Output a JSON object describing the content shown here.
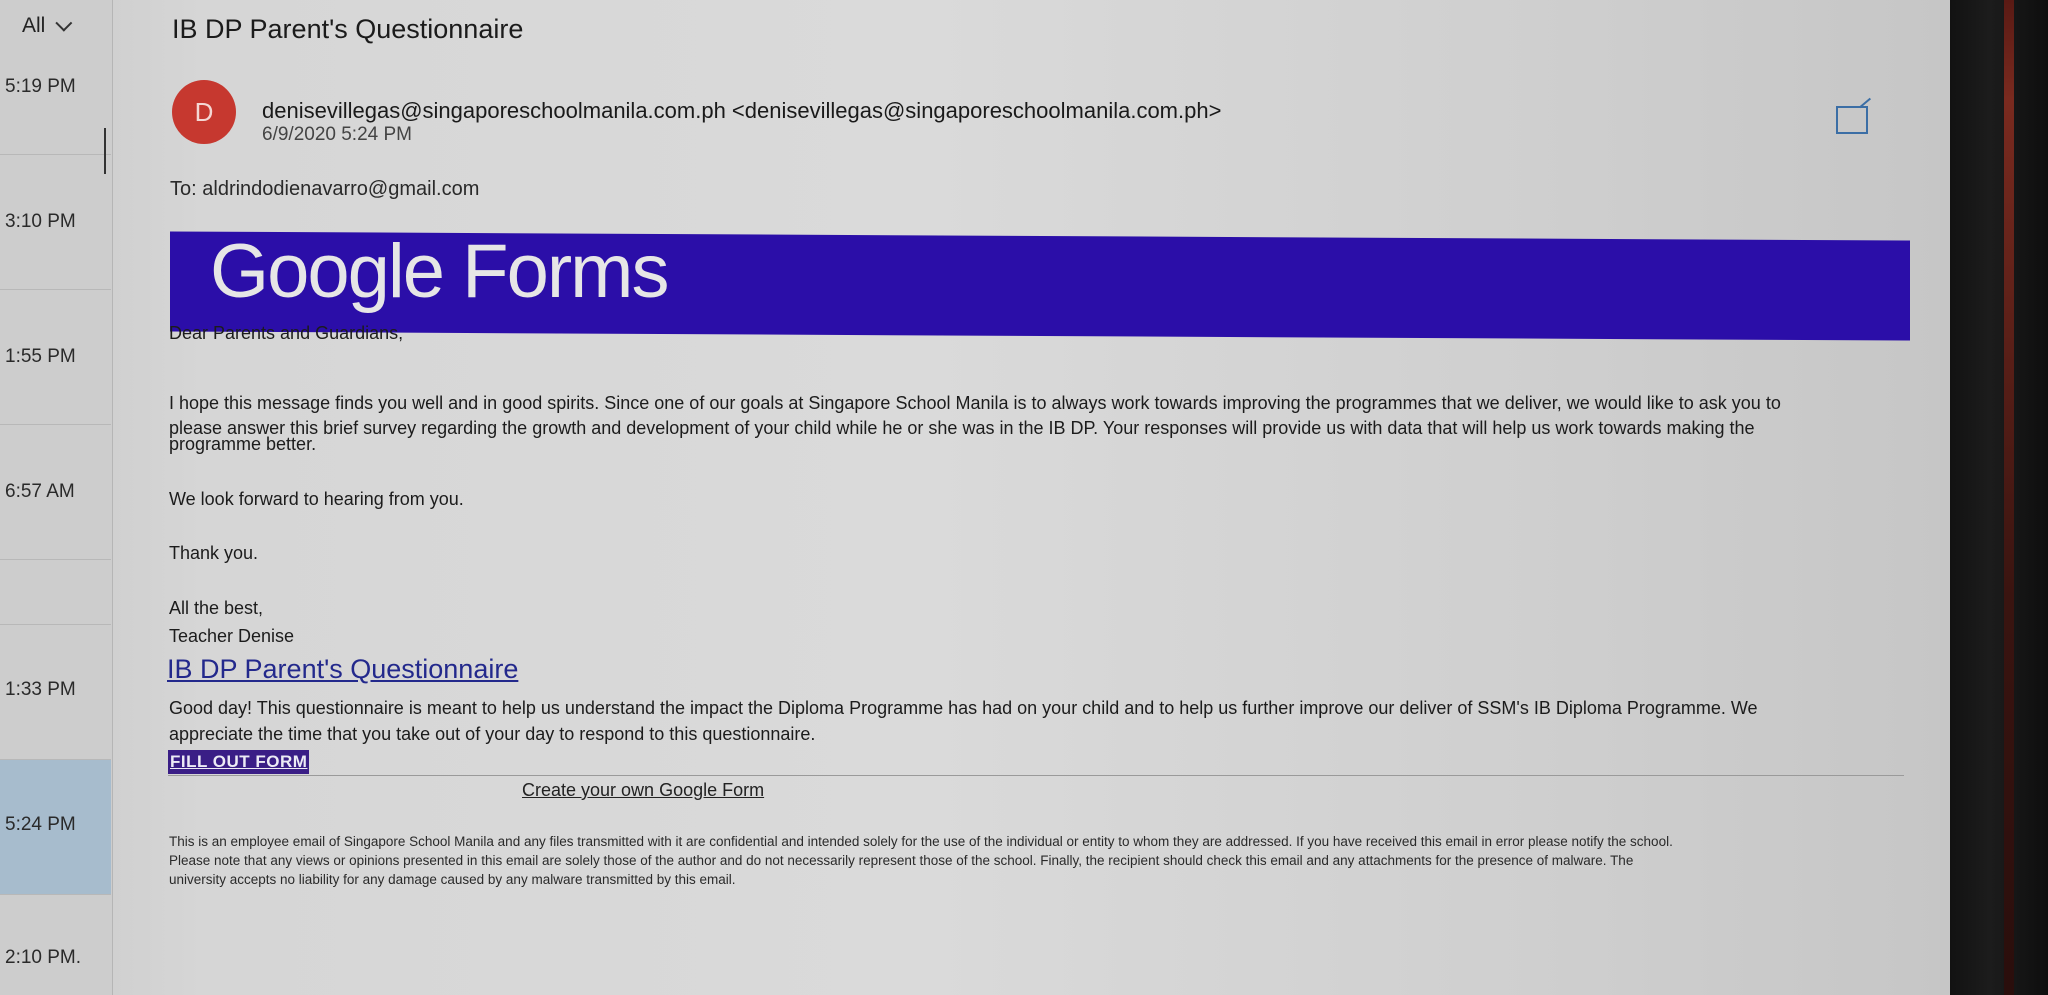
{
  "message_list": {
    "filter_label": "All",
    "times": [
      "5:19 PM",
      "3:10 PM",
      "1:55 PM",
      "6:57 AM",
      "1:33 PM",
      "5:24 PM",
      "2:10 PM."
    ]
  },
  "email": {
    "subject": "IB DP Parent's Questionnaire",
    "avatar_letter": "D",
    "sender": "denisevillegas@singaporeschoolmanila.com.ph <denisevillegas@singaporeschoolmanila.com.ph>",
    "date": "6/9/2020 5:24 PM",
    "to_label": "To:",
    "to_address": "aldrindodienavarro@gmail.com",
    "banner_logo": "Google Forms",
    "greeting": "Dear Parents and Guardians,",
    "paragraph1_line1": "I hope this message finds you well and in good spirits. Since one of our goals at Singapore School Manila is to always work towards improving the programmes that we deliver, we would like to ask you to",
    "paragraph1_line2": "please answer this brief survey regarding the growth and development of your child while he or she was in the IB DP. Your responses will provide us with data that will help us work towards making the",
    "paragraph1_line3": "programme better.",
    "paragraph2": "We look forward to hearing from you.",
    "thanks": "Thank you.",
    "signoff": "All the best,",
    "signature": "Teacher Denise",
    "form_title": "IB DP Parent's Questionnaire",
    "form_desc_line1": "Good day! This questionnaire is meant to help us understand the impact the Diploma Programme has had on your child and to help us further improve our deliver of SSM's IB Diploma Programme. We",
    "form_desc_line2": "appreciate the time that you take out of your day to respond to this questionnaire.",
    "fill_out_label": "FILL OUT FORM",
    "create_form_label": "Create your own Google Form",
    "disclaimer_line1": "This is an employee email of Singapore School Manila and any files transmitted with it are confidential and intended solely for the use of the individual or entity to whom they are addressed. If you have received this email in error please notify the school.",
    "disclaimer_line2": "Please note that any views or opinions presented in this email are solely those of the author and do not necessarily represent those of the school. Finally, the recipient should check this email and any attachments for the presence of malware. The",
    "disclaimer_line3": "university accepts no liability for any damage caused by any malware transmitted by this email."
  },
  "colors": {
    "banner": "#2b0ea8",
    "avatar": "#c6382f",
    "selected_item": "#a7bccd",
    "link": "#23298c"
  }
}
